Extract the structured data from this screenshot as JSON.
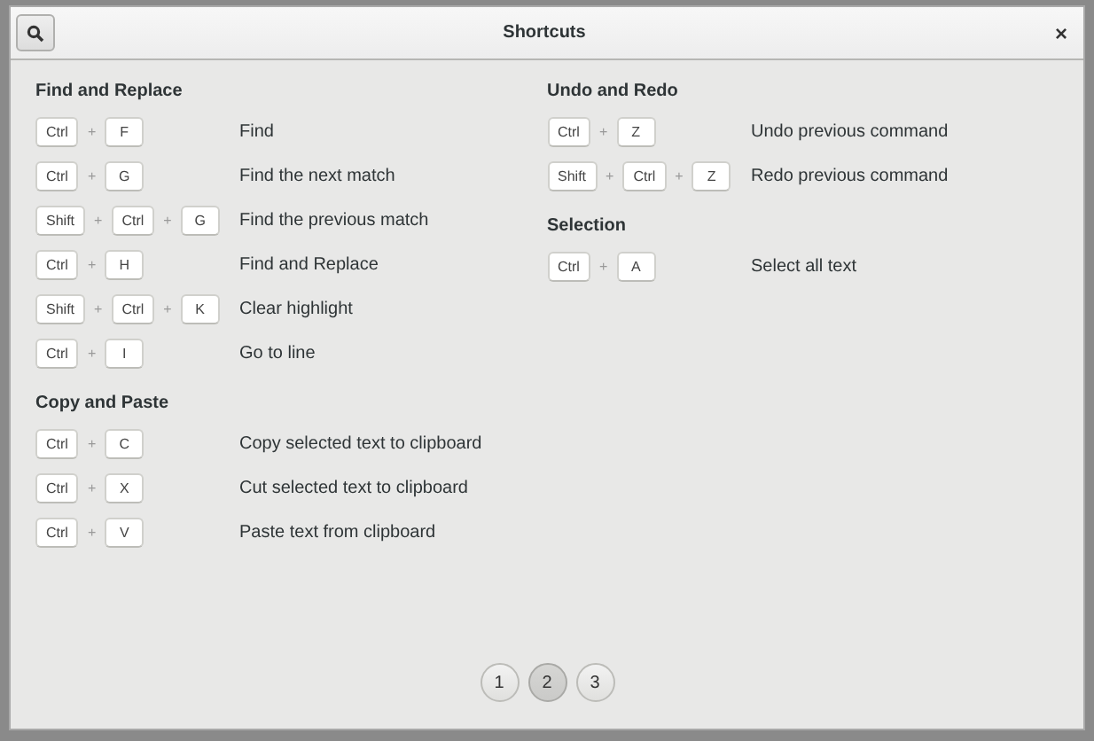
{
  "window": {
    "title": "Shortcuts",
    "close": "×"
  },
  "columns": [
    {
      "sections": [
        {
          "title": "Find and Replace",
          "shortcuts": [
            {
              "keys": [
                {
                  "kind": "key",
                  "text": "Ctrl"
                },
                {
                  "kind": "plus",
                  "text": "+"
                },
                {
                  "kind": "key",
                  "text": "F"
                }
              ],
              "description": "Find"
            },
            {
              "keys": [
                {
                  "kind": "key",
                  "text": "Ctrl"
                },
                {
                  "kind": "plus",
                  "text": "+"
                },
                {
                  "kind": "key",
                  "text": "G"
                }
              ],
              "description": "Find the next match"
            },
            {
              "keys": [
                {
                  "kind": "key",
                  "text": "Shift"
                },
                {
                  "kind": "plus",
                  "text": "+"
                },
                {
                  "kind": "key",
                  "text": "Ctrl"
                },
                {
                  "kind": "plus",
                  "text": "+"
                },
                {
                  "kind": "key",
                  "text": "G"
                }
              ],
              "description": "Find the previous match"
            },
            {
              "keys": [
                {
                  "kind": "key",
                  "text": "Ctrl"
                },
                {
                  "kind": "plus",
                  "text": "+"
                },
                {
                  "kind": "key",
                  "text": "H"
                }
              ],
              "description": "Find and Replace"
            },
            {
              "keys": [
                {
                  "kind": "key",
                  "text": "Shift"
                },
                {
                  "kind": "plus",
                  "text": "+"
                },
                {
                  "kind": "key",
                  "text": "Ctrl"
                },
                {
                  "kind": "plus",
                  "text": "+"
                },
                {
                  "kind": "key",
                  "text": "K"
                }
              ],
              "description": "Clear highlight"
            },
            {
              "keys": [
                {
                  "kind": "key",
                  "text": "Ctrl"
                },
                {
                  "kind": "plus",
                  "text": "+"
                },
                {
                  "kind": "key",
                  "text": "I"
                }
              ],
              "description": "Go to line"
            }
          ]
        },
        {
          "title": "Copy and Paste",
          "shortcuts": [
            {
              "keys": [
                {
                  "kind": "key",
                  "text": "Ctrl"
                },
                {
                  "kind": "plus",
                  "text": "+"
                },
                {
                  "kind": "key",
                  "text": "C"
                }
              ],
              "description": "Copy selected text to clipboard"
            },
            {
              "keys": [
                {
                  "kind": "key",
                  "text": "Ctrl"
                },
                {
                  "kind": "plus",
                  "text": "+"
                },
                {
                  "kind": "key",
                  "text": "X"
                }
              ],
              "description": "Cut selected text to clipboard"
            },
            {
              "keys": [
                {
                  "kind": "key",
                  "text": "Ctrl"
                },
                {
                  "kind": "plus",
                  "text": "+"
                },
                {
                  "kind": "key",
                  "text": "V"
                }
              ],
              "description": "Paste text from clipboard"
            }
          ]
        }
      ]
    },
    {
      "sections": [
        {
          "title": "Undo and Redo",
          "shortcuts": [
            {
              "keys": [
                {
                  "kind": "key",
                  "text": "Ctrl"
                },
                {
                  "kind": "plus",
                  "text": "+"
                },
                {
                  "kind": "key",
                  "text": "Z"
                }
              ],
              "description": "Undo previous command"
            },
            {
              "keys": [
                {
                  "kind": "key",
                  "text": "Shift"
                },
                {
                  "kind": "plus",
                  "text": "+"
                },
                {
                  "kind": "key",
                  "text": "Ctrl"
                },
                {
                  "kind": "plus",
                  "text": "+"
                },
                {
                  "kind": "key",
                  "text": "Z"
                }
              ],
              "description": "Redo previous command"
            }
          ]
        },
        {
          "title": "Selection",
          "shortcuts": [
            {
              "keys": [
                {
                  "kind": "key",
                  "text": "Ctrl"
                },
                {
                  "kind": "plus",
                  "text": "+"
                },
                {
                  "kind": "key",
                  "text": "A"
                }
              ],
              "description": "Select all text"
            }
          ]
        }
      ]
    }
  ],
  "pages": [
    {
      "label": "1",
      "selected": false
    },
    {
      "label": "2",
      "selected": true
    },
    {
      "label": "3",
      "selected": false
    }
  ]
}
